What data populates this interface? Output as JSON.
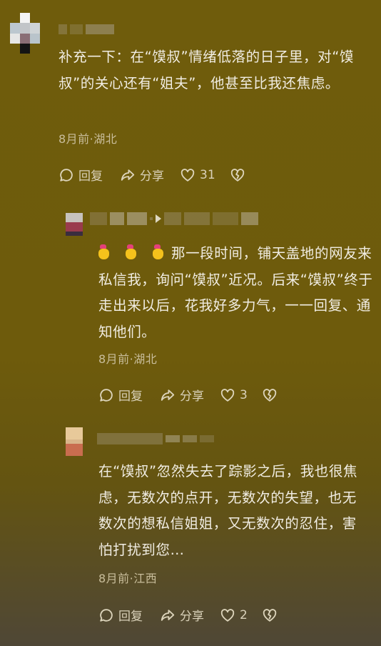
{
  "comments": [
    {
      "text": "补充一下：在“馍叔”情绪低落的日子里，对“馍叔”的关心还有“姐夫”，他甚至比我还焦虑。",
      "meta": "8月前·湖北",
      "reply_label": "回复",
      "share_label": "分享",
      "like_count": "31"
    },
    {
      "emoji_icon": "crossed-fingers-icon",
      "text": "那一段时间，铺天盖地的网友来私信我，询问“馍叔”近况。后来“馍叔”终于走出来以后，花我好多力气，一一回复、通知他们。",
      "meta": "8月前·湖北",
      "reply_label": "回复",
      "share_label": "分享",
      "like_count": "3"
    },
    {
      "text": "在“馍叔”忽然失去了踪影之后，我也很焦虑，无数次的点开，无数次的失望，也无数次的想私信姐姐，又无数次的忍住，害怕打扰到您…",
      "meta": "8月前·江西",
      "reply_label": "回复",
      "share_label": "分享",
      "like_count": "2"
    }
  ],
  "colors": {
    "background": "#6f5c0c",
    "text": "#f1ede3",
    "meta": "#c9be9c"
  }
}
